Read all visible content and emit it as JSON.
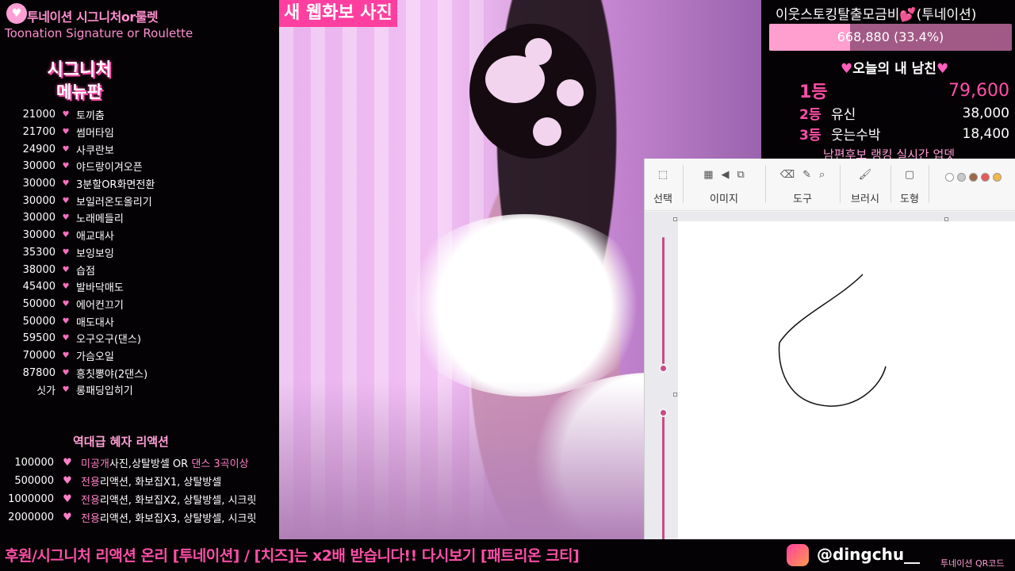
{
  "left": {
    "header_title": "투네이션 시그니처or룰렛",
    "header_sub": "Toonation Signature or Roulette",
    "menu_title_1": "시그니처",
    "menu_title_2": "메뉴판",
    "signatures": [
      {
        "amount": "21000",
        "name": "토끼춤"
      },
      {
        "amount": "21700",
        "name": "썸머타임"
      },
      {
        "amount": "24900",
        "name": "사쿠란보"
      },
      {
        "amount": "30000",
        "name": "야드랑이겨오픈"
      },
      {
        "amount": "30000",
        "name": "3분할OR화면전환"
      },
      {
        "amount": "30000",
        "name": "보일러온도올리기"
      },
      {
        "amount": "30000",
        "name": "노래메들리"
      },
      {
        "amount": "30000",
        "name": "애교대사"
      },
      {
        "amount": "35300",
        "name": "보잉보잉"
      },
      {
        "amount": "38000",
        "name": "습점"
      },
      {
        "amount": "45400",
        "name": "발바닥매도"
      },
      {
        "amount": "50000",
        "name": "에어컨끄기"
      },
      {
        "amount": "50000",
        "name": "매도대사"
      },
      {
        "amount": "59500",
        "name": "오구오구(댄스)"
      },
      {
        "amount": "70000",
        "name": "가슴오일"
      },
      {
        "amount": "87800",
        "name": "흥칫뽕야(2댄스)"
      },
      {
        "amount": "싯가",
        "name": "롱패딩입히기"
      }
    ],
    "reaction_title": "역대급 혜자 리액션",
    "reactions": [
      {
        "amount": "100000",
        "highlight": "미공개",
        "desc": "사진,상탈방셀 OR ",
        "highlight2": "댄스 3곡이상"
      },
      {
        "amount": "500000",
        "highlight": "전용",
        "desc": "리액션, 화보집X1, 상탈방셀",
        "highlight2": ""
      },
      {
        "amount": "1000000",
        "highlight": "전용",
        "desc": "리액션, 화보집X2, 상탈방셀, 시크릿",
        "highlight2": ""
      },
      {
        "amount": "2000000",
        "highlight": "전용",
        "desc": "리액션, 화보집X3, 상탈방셀, 시크릿",
        "highlight2": ""
      }
    ]
  },
  "video": {
    "banner": "새 웹화보 사진"
  },
  "goal": {
    "title": "이웃스토킹탈출모금비💕(투네이션)",
    "progress_text": "668,880 (33.4%)",
    "progress": 0.334
  },
  "ranking": {
    "title": "오늘의 내 남친",
    "rows": [
      {
        "place": "1등",
        "name": "",
        "amount": "79,600"
      },
      {
        "place": "2등",
        "name": "유신",
        "amount": "38,000"
      },
      {
        "place": "3등",
        "name": "웃는수박",
        "amount": "18,400"
      }
    ],
    "footer": "남편후보 랭킹 실시간 업뎃"
  },
  "paint": {
    "groups": [
      "선택",
      "이미지",
      "도구",
      "브러시",
      "도형"
    ],
    "colors": [
      "#ffffff",
      "#c9c9c9",
      "#9a6a4a",
      "#e55b5b",
      "#f2b84a"
    ]
  },
  "bottom": {
    "text_a": "후원/시그니처 리액션 온리 [투네이션] / [치즈]는 x2배 받습니다!! 다시보기 [패트리온 크티]",
    "insta": "@dingchu__",
    "qr": "투네이션 QR코드"
  }
}
